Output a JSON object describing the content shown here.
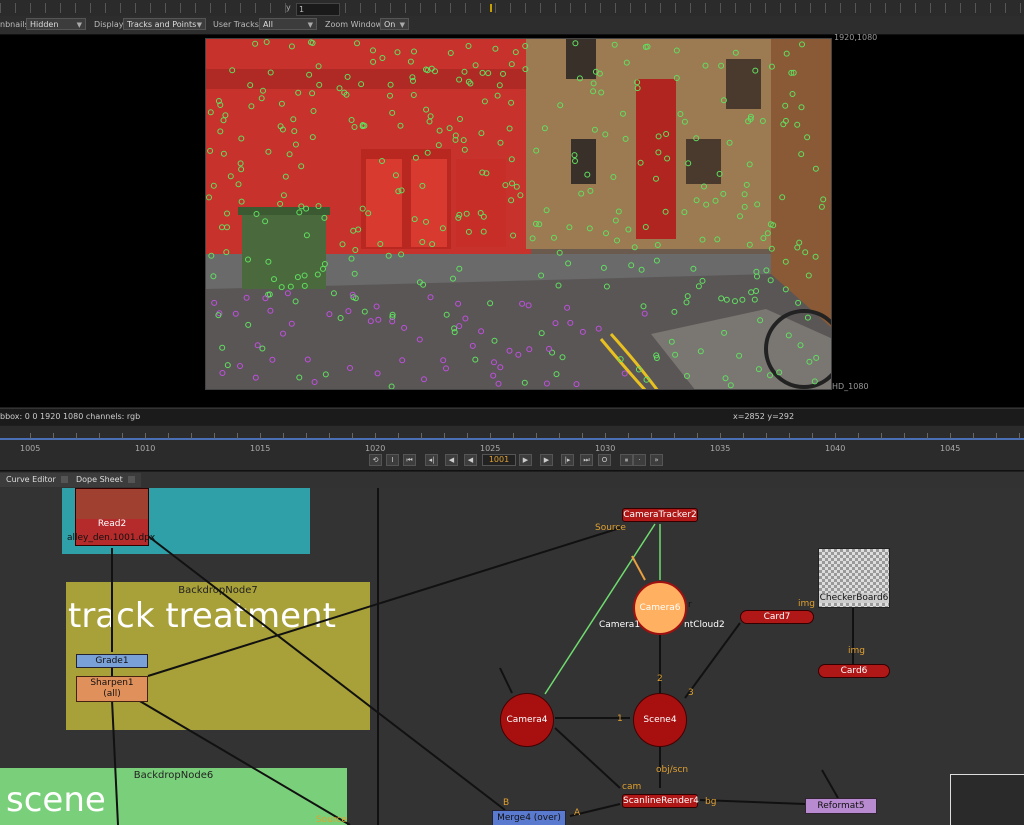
{
  "topruler": {
    "y_label": "y",
    "y_value": "1"
  },
  "controls": {
    "thumbnails_label": "nbnails",
    "thumbnails_value": "Hidden",
    "display_label": "Display",
    "display_value": "Tracks and Points",
    "user_tracks_label": "User Tracks",
    "user_tracks_value": "All",
    "zoom_window_label": "Zoom Window",
    "zoom_window_value": "On"
  },
  "viewer": {
    "format_top": "1920,1080",
    "format_bottom": "HD_1080",
    "bbox_text": "bbox: 0 0 1920 1080 channels: rgb",
    "coords": "x=2852 y=292"
  },
  "timeline": {
    "ticks": [
      "1005",
      "1010",
      "1015",
      "1020",
      "1025",
      "1030",
      "1035",
      "1040",
      "1045"
    ],
    "current_frame": "1001"
  },
  "tabs": [
    "Curve Editor",
    "Dope Sheet"
  ],
  "nodes": {
    "read2": "Read2",
    "read2_file": "alley_den.1001.dpx",
    "backdrop7": "BackdropNode7",
    "backdrop7_text": "track treatment",
    "grade1": "Grade1",
    "sharpen1": "Sharpen1",
    "sharpen1_sub": "(all)",
    "backdrop6": "BackdropNode6",
    "backdrop6_text": "scene",
    "camtracker": "CameraTracker2",
    "source1": "Source",
    "source2": "Source",
    "camera6": "Camera6",
    "camera1": "Camera1",
    "pointcloud": "ntCloud2",
    "r_label": "r",
    "card7": "Card7",
    "img1": "img",
    "img2": "img",
    "checker": "CheckerBoard6",
    "card6": "Card6",
    "camera4": "Camera4",
    "scene4": "Scene4",
    "num1": "1",
    "num2": "2",
    "num3": "3",
    "objscn": "obj/scn",
    "cam": "cam",
    "scanline": "ScanlineRender4",
    "bg": "bg",
    "merge": "Merge4 (over)",
    "b_in": "B",
    "a_in": "A",
    "reformat": "Reformat5"
  }
}
